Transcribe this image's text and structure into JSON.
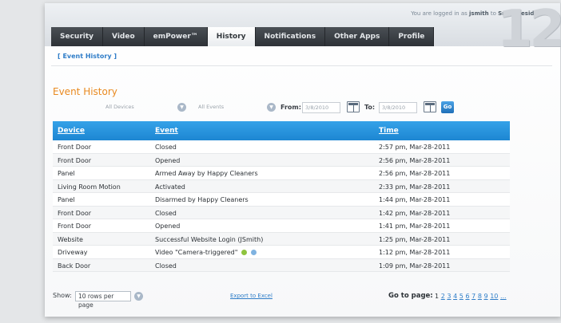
{
  "header": {
    "login_prefix": "You are logged in as",
    "username": "jsmith",
    "login_mid": "to",
    "residence": "Smith residence",
    "badge": "12"
  },
  "nav": [
    {
      "label": "Security",
      "name": "nav-tab-security"
    },
    {
      "label": "Video",
      "name": "nav-tab-video"
    },
    {
      "label": "emPower™",
      "name": "nav-tab-empower"
    },
    {
      "label": "History",
      "name": "nav-tab-history",
      "active": true
    },
    {
      "label": "Notifications",
      "name": "nav-tab-notifications"
    },
    {
      "label": "Other Apps",
      "name": "nav-tab-other-apps"
    },
    {
      "label": "Profile",
      "name": "nav-tab-profile"
    }
  ],
  "breadcrumb": "[ Event History ]",
  "page_title": "Event History",
  "filters": {
    "devices_value": "All Devices",
    "events_value": "All Events",
    "from_label": "From:",
    "from_value": "3/8/2010",
    "to_label": "To:",
    "to_value": "3/8/2010",
    "go_label": "Go"
  },
  "table": {
    "columns": [
      "Device",
      "Event",
      "Time"
    ],
    "rows": [
      {
        "device": "Front Door",
        "event": "Closed",
        "time": "2:57 pm, Mar-28-2011"
      },
      {
        "device": "Front Door",
        "event": "Opened",
        "time": "2:56 pm, Mar-28-2011"
      },
      {
        "device": "Panel",
        "event": "Armed Away by Happy Cleaners",
        "time": "2:56 pm, Mar-28-2011"
      },
      {
        "device": "Living Room Motion",
        "event": "Activated",
        "time": "2:33 pm, Mar-28-2011"
      },
      {
        "device": "Panel",
        "event": "Disarmed by Happy Cleaners",
        "time": "1:44 pm, Mar-28-2011"
      },
      {
        "device": "Front Door",
        "event": "Closed",
        "time": "1:42 pm, Mar-28-2011"
      },
      {
        "device": "Front Door",
        "event": "Opened",
        "time": "1:41 pm, Mar-28-2011"
      },
      {
        "device": "Website",
        "event": "Successful Website Login (JSmith)",
        "time": "1:25 pm, Mar-28-2011"
      },
      {
        "device": "Driveway",
        "event": "Video \"Camera-triggered\"",
        "time": "1:12 pm, Mar-28-2011",
        "video_icons": true
      },
      {
        "device": "Back Door",
        "event": "Closed",
        "time": "1:09 pm, Mar-28-2011"
      }
    ]
  },
  "footer": {
    "show_label": "Show:",
    "rows_per_page": "10 rows per page",
    "export_label": "Export to Excel",
    "goto_label": "Go to page:",
    "pages": [
      "1",
      "2",
      "3",
      "4",
      "5",
      "6",
      "7",
      "8",
      "9",
      "10",
      "..."
    ]
  },
  "colors": {
    "accent_orange": "#e98a20",
    "table_header_blue": "#1d86d2",
    "link_blue": "#2f7dc8",
    "nav_dark": "#3b3f44"
  },
  "icons": {
    "from_calendar": "calendar-icon",
    "to_calendar": "calendar-icon",
    "select_arrow": "chevron-down-icon",
    "video_play": "play-icon",
    "video_info": "info-icon"
  }
}
